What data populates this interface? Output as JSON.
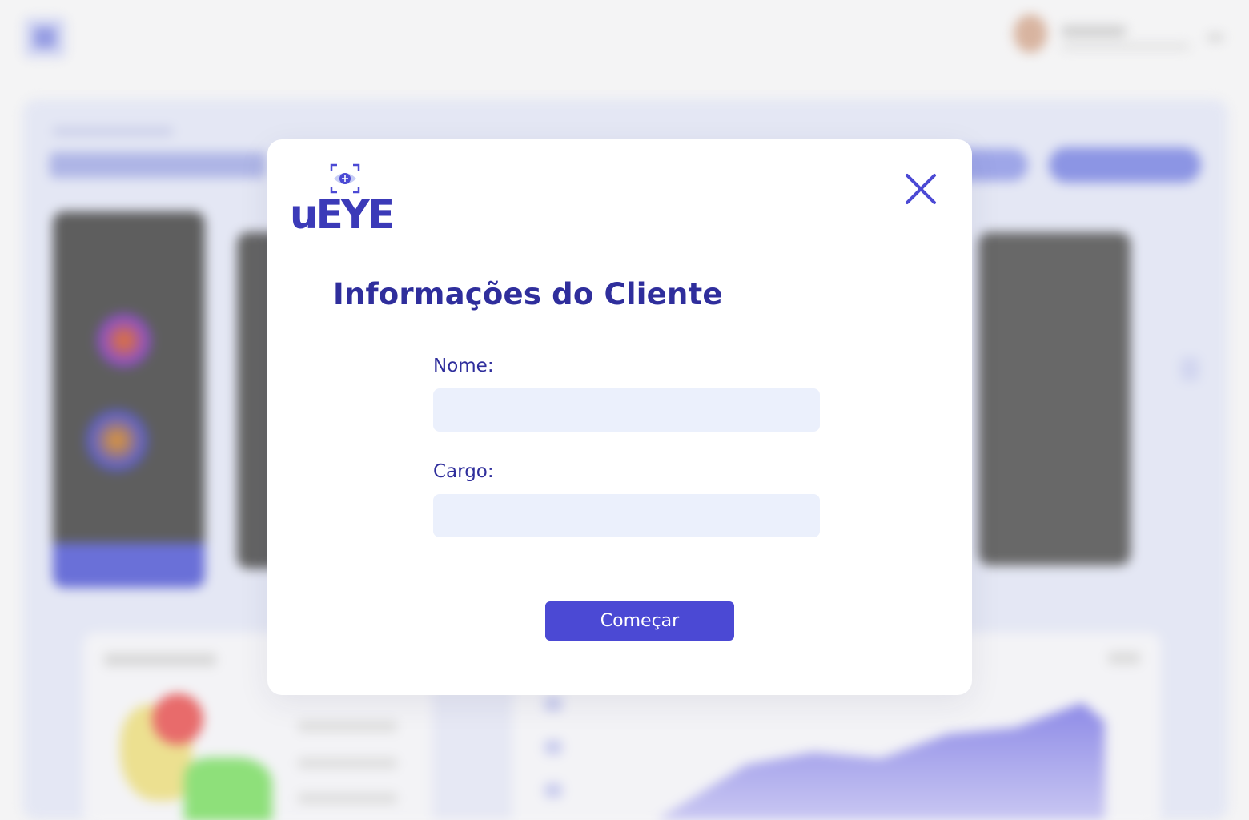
{
  "brand": {
    "name": "uEYE",
    "icon": "eye-scan-icon",
    "colors": {
      "primary": "#4b49d4",
      "dark": "#3b3ab8"
    }
  },
  "modal": {
    "title": "Informações do Cliente",
    "close_icon": "close-icon",
    "fields": [
      {
        "label": "Nome:",
        "value": "",
        "placeholder": ""
      },
      {
        "label": "Cargo:",
        "value": "",
        "placeholder": ""
      }
    ],
    "submit_label": "Começar"
  },
  "colors": {
    "heading": "#2f2e9c",
    "input_background": "#ebf0fc",
    "button_background": "#4b49d4",
    "modal_background": "#ffffff"
  }
}
